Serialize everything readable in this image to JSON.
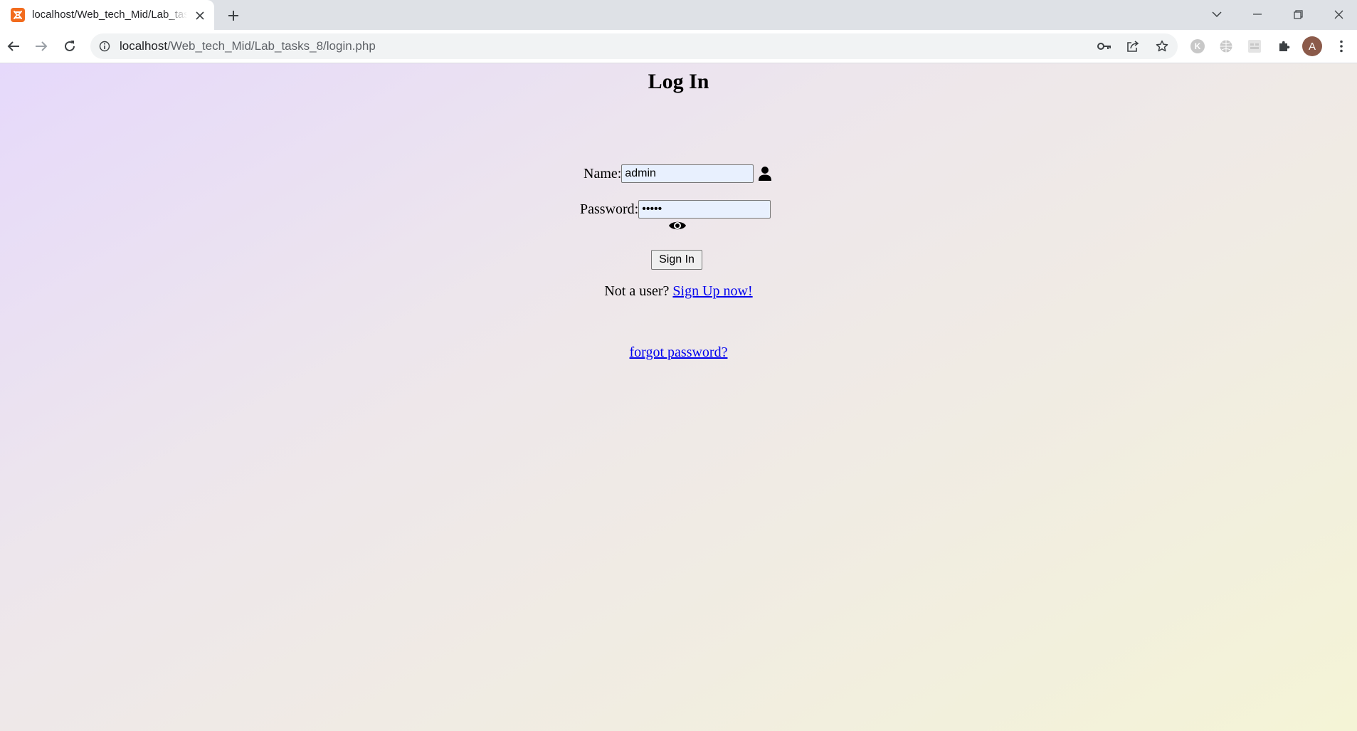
{
  "browser": {
    "tab": {
      "title": "localhost/Web_tech_Mid/Lab_tasks_8/login.php",
      "favicon": "xampp-icon"
    },
    "window_controls": [
      "chevron-down-icon",
      "minimize-icon",
      "restore-icon",
      "close-icon"
    ],
    "address": {
      "host": "localhost",
      "path": "/Web_tech_Mid/Lab_tasks_8/login.php"
    },
    "profile_initial": "A",
    "extension_initial": "K",
    "accent_color": "#f26b1d",
    "avatar_color": "#8b5a4a"
  },
  "page": {
    "title": "Log In",
    "name_label": "Name:",
    "name_value": "admin",
    "password_label": "Password:",
    "password_value": "•••••",
    "sign_in_label": "Sign In",
    "not_user_text": "Not a user?",
    "sign_up_link": "Sign Up now!",
    "forgot_link": "forgot password?",
    "link_color": "#0000ee"
  }
}
